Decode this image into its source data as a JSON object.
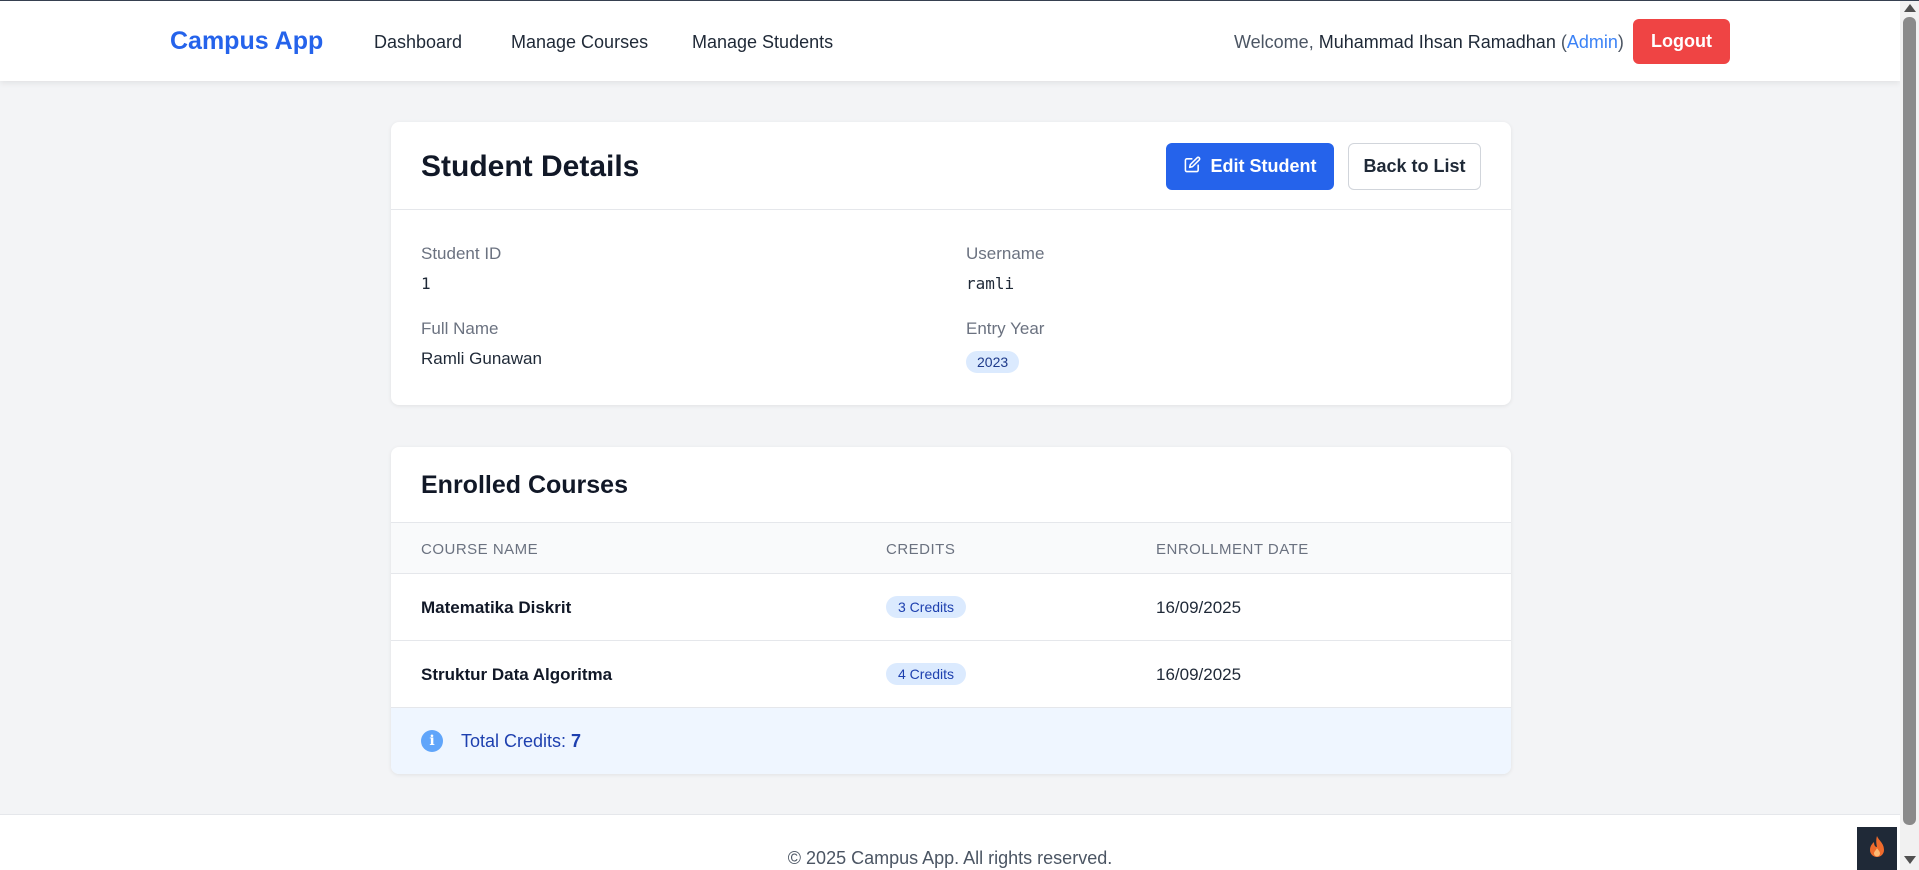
{
  "navbar": {
    "brand": "Campus App",
    "links": [
      "Dashboard",
      "Manage Courses",
      "Manage Students"
    ],
    "welcome_prefix": "Welcome, ",
    "user_name": "Muhammad Ihsan Ramadhan",
    "role_open": " (",
    "role": "Admin",
    "role_close": ")",
    "logout_label": "Logout"
  },
  "details": {
    "title": "Student Details",
    "edit_label": "Edit Student",
    "back_label": "Back to List",
    "student_id_label": "Student ID",
    "student_id": "1",
    "username_label": "Username",
    "username": "ramli",
    "full_name_label": "Full Name",
    "full_name": "Ramli Gunawan",
    "entry_year_label": "Entry Year",
    "entry_year": "2023"
  },
  "courses": {
    "title": "Enrolled Courses",
    "headers": [
      "COURSE NAME",
      "CREDITS",
      "ENROLLMENT DATE"
    ],
    "rows": [
      {
        "name": "Matematika Diskrit",
        "credits": "3 Credits",
        "date": "16/09/2025"
      },
      {
        "name": "Struktur Data Algoritma",
        "credits": "4 Credits",
        "date": "16/09/2025"
      }
    ],
    "total_label": "Total Credits: ",
    "total_value": "7"
  },
  "footer": {
    "text": "© 2025 Campus App. All rights reserved."
  },
  "icons": {
    "edit": "edit-icon",
    "info": "info-icon",
    "debug": "fire-icon"
  },
  "colors": {
    "primary": "#2563eb",
    "danger": "#ef4444",
    "badge_bg": "#dbeafe",
    "info_bg": "#eff6ff"
  }
}
